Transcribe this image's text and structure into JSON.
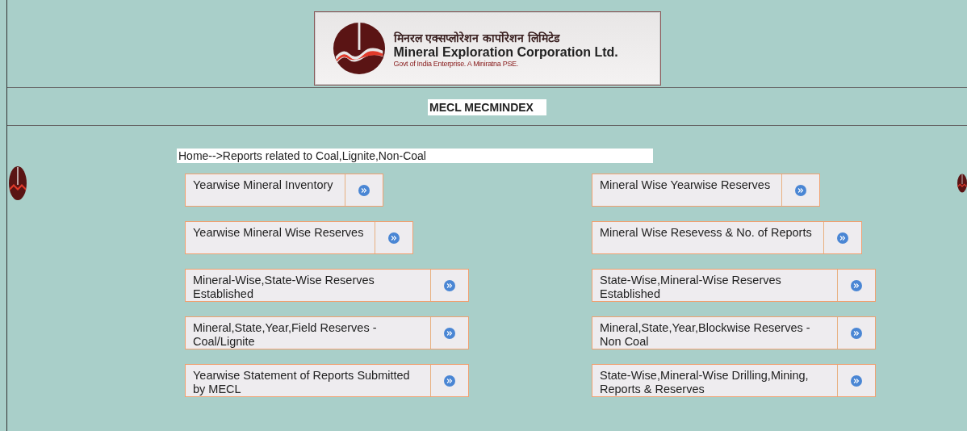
{
  "header": {
    "name_hindi": "मिनरल एक्सप्लोरेशन कार्पोरेशन लिमिटेड",
    "name": "Mineral Exploration Corporation Ltd.",
    "tagline": "Govt of India Enterprise. A Miniratna PSE."
  },
  "page_title": "MECL MECMINDEX",
  "breadcrumb": "Home-->Reports related to Coal,Lignite,Non-Coal",
  "reports": [
    {
      "left": "Yearwise Mineral Inventory",
      "right": "Mineral Wise Yearwise Reserves"
    },
    {
      "left": "Yearwise Mineral Wise Reserves",
      "right": "Mineral Wise Resevess & No. of Reports"
    },
    {
      "left": "Mineral-Wise,State-Wise Reserves Established",
      "right": "State-Wise,Mineral-Wise Reserves Established"
    },
    {
      "left": "Mineral,State,Year,Field Reserves -Coal/Lignite",
      "right": "Mineral,State,Year,Blockwise Reserves -Non Coal"
    },
    {
      "left": "Yearwise Statement of Reports Submitted by MECL",
      "right": "State-Wise,Mineral-Wise Drilling,Mining, Reports & Reserves"
    }
  ]
}
